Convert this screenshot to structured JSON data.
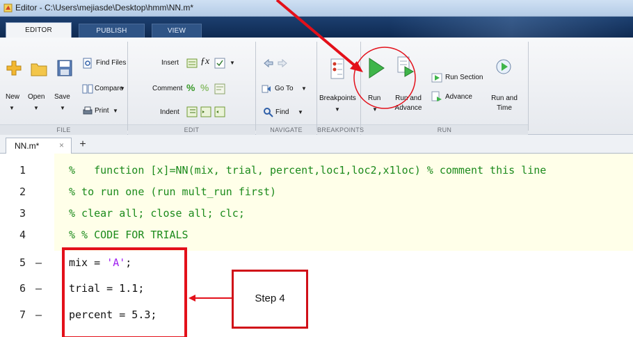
{
  "window": {
    "title": "Editor - C:\\Users\\mejiasde\\Desktop\\hmm\\NN.m*"
  },
  "tabs": [
    {
      "label": "EDITOR",
      "active": true
    },
    {
      "label": "PUBLISH",
      "active": false
    },
    {
      "label": "VIEW",
      "active": false
    }
  ],
  "ribbon": {
    "file": {
      "new_label": "New",
      "open_label": "Open",
      "save_label": "Save",
      "find_files_label": "Find Files",
      "compare_label": "Compare",
      "print_label": "Print",
      "group_label": "FILE"
    },
    "edit": {
      "insert_label": "Insert",
      "comment_label": "Comment",
      "indent_label": "Indent",
      "group_label": "EDIT"
    },
    "navigate": {
      "goto_label": "Go To",
      "find_label": "Find",
      "group_label": "NAVIGATE"
    },
    "breakpoints": {
      "breakpoints_label": "Breakpoints",
      "group_label": "BREAKPOINTS"
    },
    "run": {
      "run_label": "Run",
      "run_advance_line1": "Run and",
      "run_advance_line2": "Advance",
      "run_section_label": "Run Section",
      "advance_label": "Advance",
      "run_time_line1": "Run and",
      "run_time_line2": "Time",
      "group_label": "RUN"
    }
  },
  "document_tab": {
    "name": "NN.m*",
    "close": "×",
    "new_tab": "+"
  },
  "editor": {
    "lines": [
      {
        "number": "1",
        "dash": "",
        "text": "%   function [x]=NN(mix, trial, percent,loc1,loc2,x1loc) % comment this line"
      },
      {
        "number": "2",
        "dash": "",
        "text": "% to run one (run mult_run first)"
      },
      {
        "number": "3",
        "dash": "",
        "text": "% clear all; close all; clc;"
      },
      {
        "number": "4",
        "dash": "",
        "text": "% % CODE FOR TRIALS"
      },
      {
        "number": "5",
        "dash": "—",
        "text_plain": "mix = ",
        "text_str": "'A'",
        "text_end": ";"
      },
      {
        "number": "6",
        "dash": "—",
        "text": "trial = 1.1;"
      },
      {
        "number": "7",
        "dash": "—",
        "text": "percent = 5.3;"
      }
    ]
  },
  "annotation": {
    "step_label": "Step 4"
  },
  "colors": {
    "annotation_red": "#e3101a",
    "comment_green": "#1b8a1b",
    "string_purple": "#a020f0",
    "code_background": "#ffffe9",
    "run_icon_green": "#3fb54a"
  }
}
